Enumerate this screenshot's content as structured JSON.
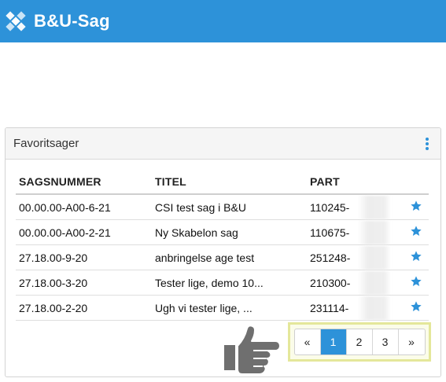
{
  "app": {
    "title": "B&U-Sag"
  },
  "panel": {
    "title": "Favoritsager"
  },
  "table": {
    "headers": [
      "SAGSNUMMER",
      "TITEL",
      "PART"
    ],
    "rows": [
      {
        "sagsnummer": "00.00.00-A00-6-21",
        "titel": "CSI test sag i B&U",
        "part": "110245-"
      },
      {
        "sagsnummer": "00.00.00-A00-2-21",
        "titel": "Ny Skabelon sag",
        "part": "110675-"
      },
      {
        "sagsnummer": "27.18.00-9-20",
        "titel": "anbringelse age test",
        "part": "251248-"
      },
      {
        "sagsnummer": "27.18.00-3-20",
        "titel": "Tester lige, demo 10...",
        "part": "210300-"
      },
      {
        "sagsnummer": "27.18.00-2-20",
        "titel": "Ugh vi tester lige, ...",
        "part": "231114-"
      }
    ]
  },
  "pagination": {
    "prev": "«",
    "pages": [
      "1",
      "2",
      "3"
    ],
    "next": "»",
    "current": "1"
  },
  "colors": {
    "brand": "#2d92d9",
    "highlight": "#e4e79a",
    "star": "#2d92d9"
  }
}
